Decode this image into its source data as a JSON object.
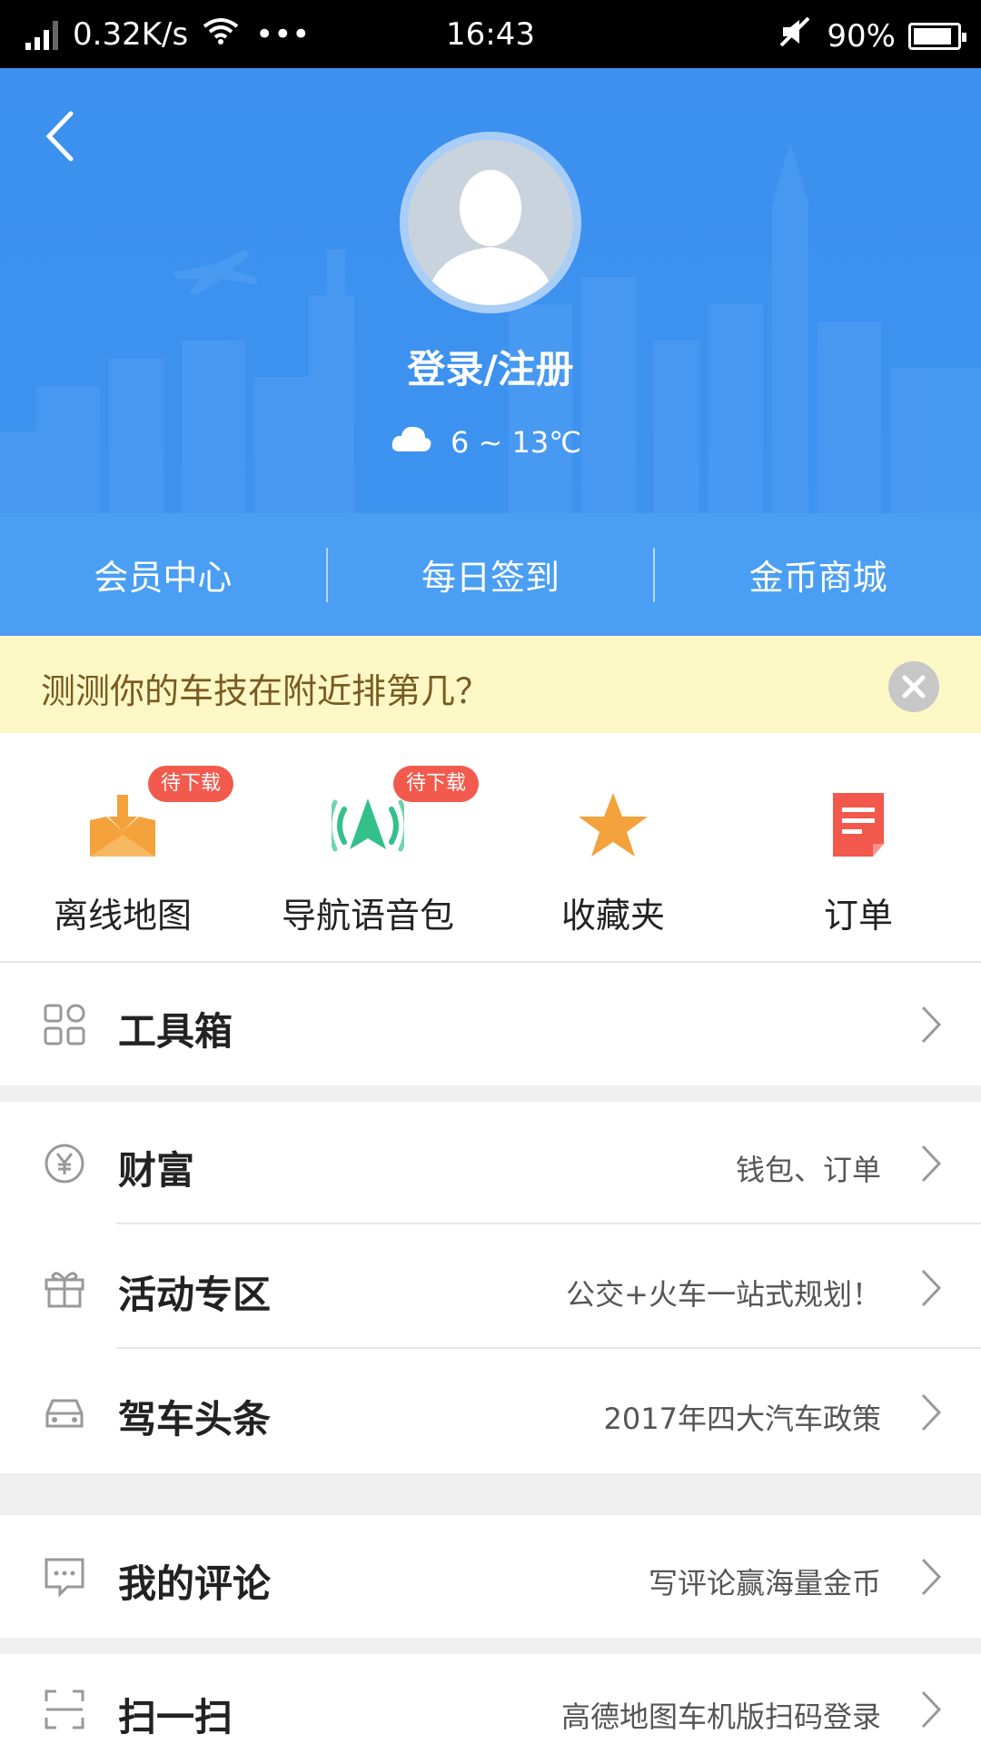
{
  "status_bar": {
    "speed": "0.32K/s",
    "dots": "•••",
    "time": "16:43",
    "battery": "90%",
    "battery_level": 0.9
  },
  "header": {
    "login_label": "登录/注册",
    "weather": "6 ~ 13℃",
    "tabs": [
      "会员中心",
      "每日签到",
      "金币商城"
    ]
  },
  "banner": {
    "text": "测测你的车技在附近排第几？"
  },
  "quick_actions": [
    {
      "label": "离线地图",
      "badge": "待下载",
      "icon": "download-map-icon",
      "color": "#f4a23c"
    },
    {
      "label": "导航语音包",
      "badge": "待下载",
      "icon": "voice-nav-icon",
      "color": "#33c08a"
    },
    {
      "label": "收藏夹",
      "badge": "",
      "icon": "star-icon",
      "color": "#f4a23c"
    },
    {
      "label": "订单",
      "badge": "",
      "icon": "order-doc-icon",
      "color": "#f2584b"
    }
  ],
  "menu": {
    "toolbox": {
      "title": "工具箱",
      "sub": ""
    },
    "wealth": {
      "title": "财富",
      "sub": "钱包、订单"
    },
    "activity": {
      "title": "活动专区",
      "sub": "公交+火车一站式规划！"
    },
    "driving_news": {
      "title": "驾车头条",
      "sub": "2017年四大汽车政策"
    },
    "comments": {
      "title": "我的评论",
      "sub": "写评论赢海量金币"
    },
    "scan": {
      "title": "扫一扫",
      "sub": "高德地图车机版扫码登录"
    }
  },
  "colors": {
    "header_blue": "#3c8fee",
    "banner_yellow": "#fcf8c6",
    "badge_red": "#f25a4d"
  }
}
